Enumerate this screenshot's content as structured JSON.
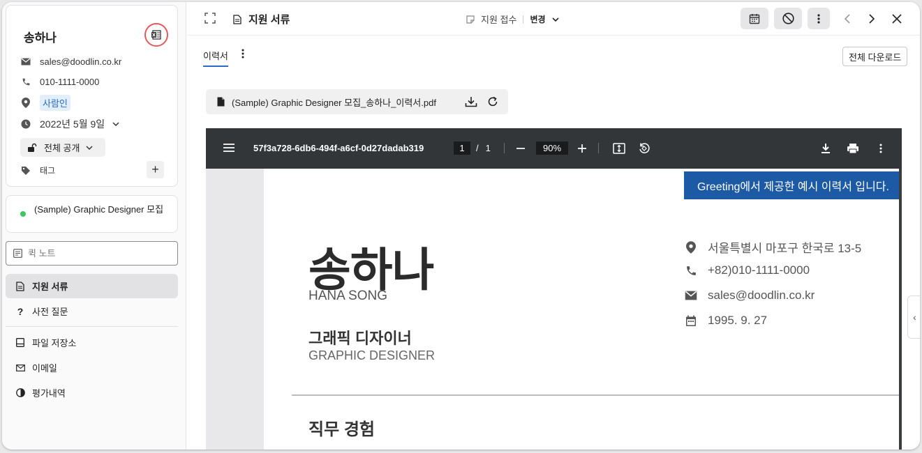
{
  "candidate": {
    "name": "송하나",
    "email": "sales@doodlin.co.kr",
    "phone": "010-1111-0000",
    "source": "사람인",
    "applied_date": "2022년 5월 9일",
    "visibility": "전체 공개",
    "tags_label": "태그"
  },
  "job": {
    "title": "(Sample) Graphic Designer 모집",
    "status_color": "#3ec75d"
  },
  "quick_note": {
    "placeholder": "퀵 노트"
  },
  "nav": {
    "items": [
      {
        "label": "지원 서류",
        "icon": "document-icon",
        "active": true
      },
      {
        "label": "사전 질문",
        "icon": "question-icon",
        "active": false
      },
      {
        "label": "파일 저장소",
        "icon": "storage-icon",
        "active": false
      },
      {
        "label": "이메일",
        "icon": "mail-icon",
        "active": false
      },
      {
        "label": "평가내역",
        "icon": "evaluation-icon",
        "active": false
      }
    ]
  },
  "topbar": {
    "title": "지원 서류",
    "stage": "지원 접수",
    "change_label": "변경"
  },
  "tabs": {
    "resume_tab": "이력서",
    "download_all": "전체 다운로드"
  },
  "file": {
    "name": "(Sample) Graphic Designer 모집_송하나_이력서.pdf"
  },
  "pdf_viewer": {
    "filename": "57f3a728-6db6-494f-a6cf-0d27dadab319",
    "current_page": "1",
    "page_separator": "/",
    "total_pages": "1",
    "zoom": "90%"
  },
  "resume": {
    "banner": "Greeting에서 제공한 예시 이력서 입니다.",
    "name": "송하나",
    "name_en": "HANA SONG",
    "role": "그래픽 디자이너",
    "role_en": "GRAPHIC DESIGNER",
    "address": "서울특별시 마포구 한국로 13-5",
    "phone": "+82)010-1111-0000",
    "email": "sales@doodlin.co.kr",
    "birth": "1995. 9. 27",
    "section_title": "직무 경험"
  },
  "colors": {
    "accent": "#2a6ac8",
    "banner": "#1d5aa6",
    "highlight_ring": "#e25a5a"
  }
}
